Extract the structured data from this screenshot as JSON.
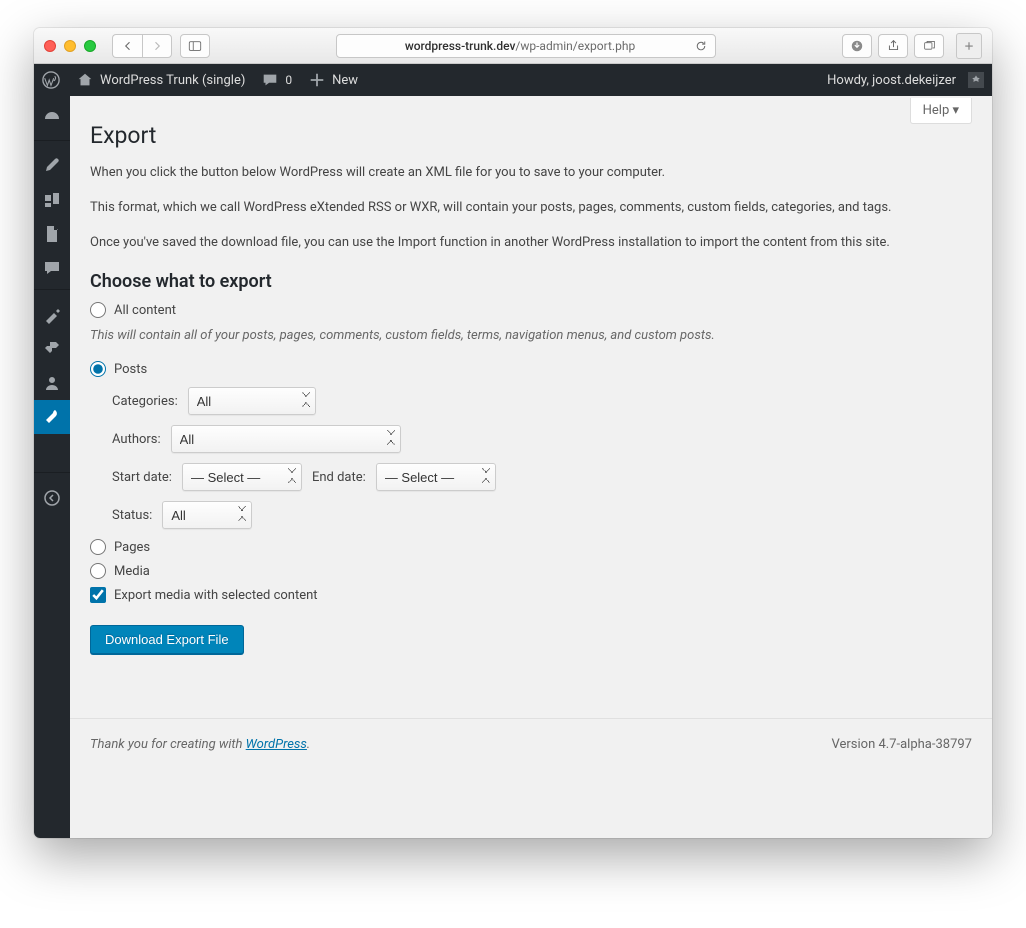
{
  "browser": {
    "url_host": "wordpress-trunk.dev",
    "url_path": "/wp-admin/export.php"
  },
  "adminbar": {
    "site_name": "WordPress Trunk (single)",
    "comments_count": "0",
    "new_label": "New",
    "howdy": "Howdy, joost.dekeijzer"
  },
  "screen": {
    "help_label": "Help",
    "title": "Export",
    "intro1": "When you click the button below WordPress will create an XML file for you to save to your computer.",
    "intro2": "This format, which we call WordPress eXtended RSS or WXR, will contain your posts, pages, comments, custom fields, categories, and tags.",
    "intro3": "Once you've saved the download file, you can use the Import function in another WordPress installation to import the content from this site.",
    "choose_heading": "Choose what to export",
    "all_content_label": "All content",
    "all_content_desc": "This will contain all of your posts, pages, comments, custom fields, terms, navigation menus, and custom posts.",
    "posts_label": "Posts",
    "pages_label": "Pages",
    "media_label": "Media",
    "export_media_label": "Export media with selected content",
    "download_button": "Download Export File"
  },
  "filters": {
    "categories_label": "Categories:",
    "categories_value": "All",
    "authors_label": "Authors:",
    "authors_value": "All",
    "start_label": "Start date:",
    "end_label": "End date:",
    "date_placeholder": "— Select —",
    "status_label": "Status:",
    "status_value": "All"
  },
  "footer": {
    "thanks_prefix": "Thank you for creating with ",
    "thanks_link": "WordPress",
    "version": "Version 4.7-alpha-38797"
  }
}
